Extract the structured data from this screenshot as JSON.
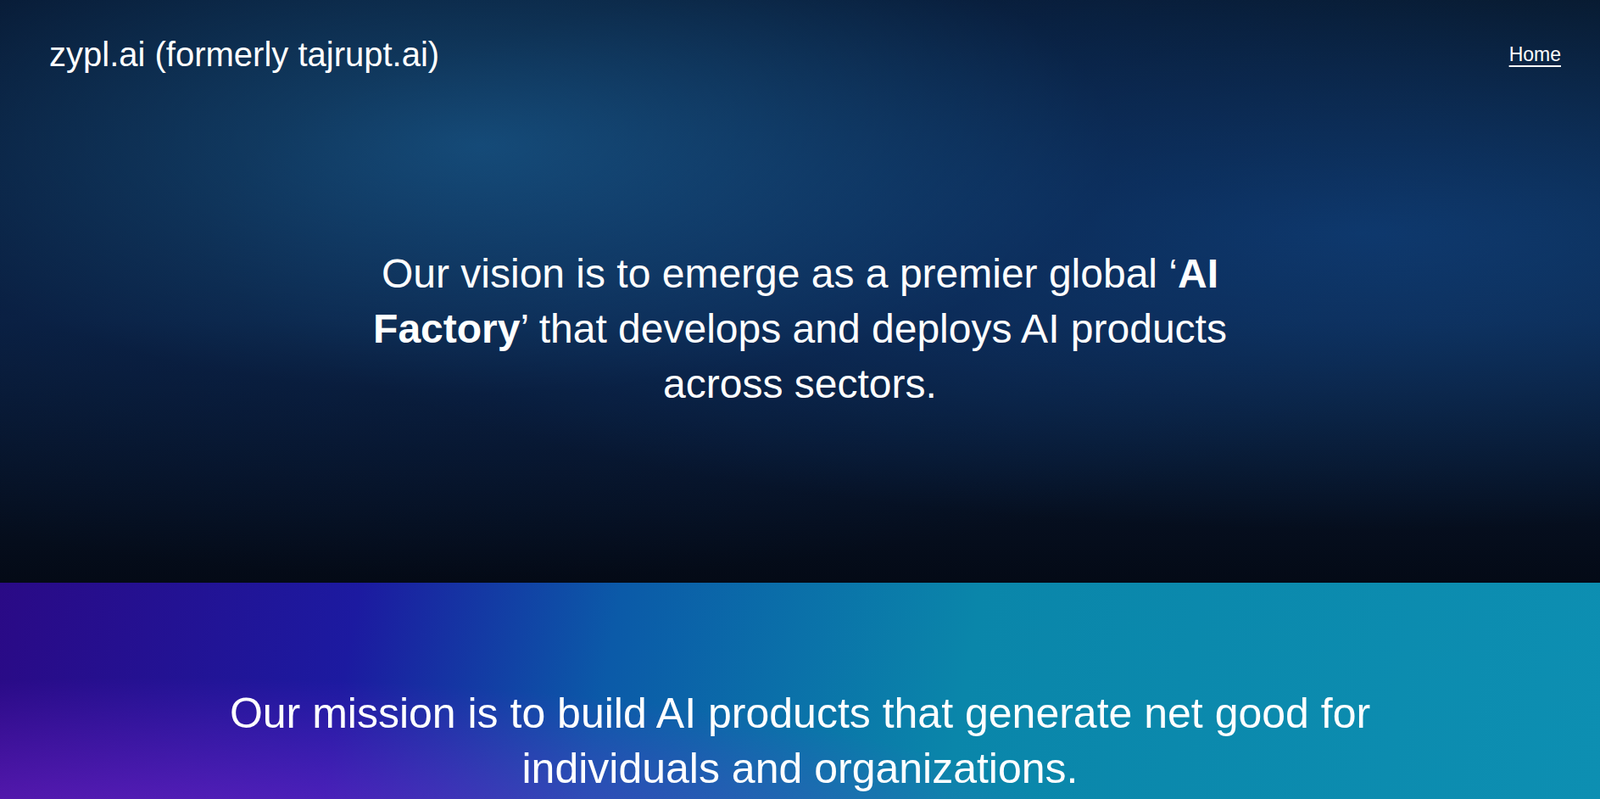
{
  "header": {
    "brand": "zypl.ai (formerly tajrupt.ai)",
    "nav": [
      {
        "label": "Home",
        "selected": true
      }
    ]
  },
  "vision": {
    "before": "Our vision is to emerge as a premier global ‘",
    "bold": "AI Factory",
    "after": "’ that develops and deploys AI products across sectors."
  },
  "mission": {
    "text": "Our mission is to build AI products that generate net good for individuals and organizations."
  }
}
